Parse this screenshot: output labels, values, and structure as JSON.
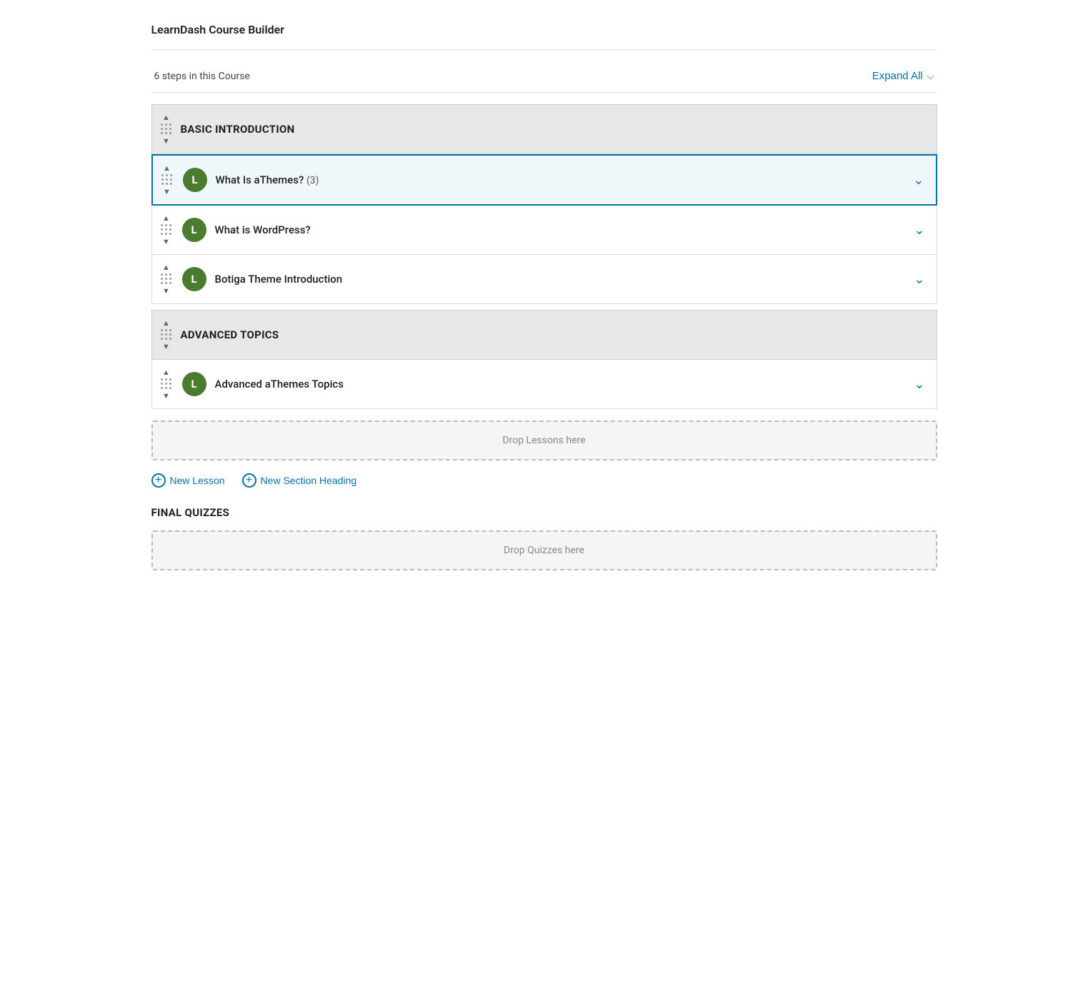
{
  "app": {
    "title": "LearnDash Course Builder"
  },
  "course": {
    "steps_count": "6 steps in this Course",
    "expand_all_label": "Expand All"
  },
  "sections": [
    {
      "type": "section-heading",
      "title": "BASIC INTRODUCTION",
      "id": "basic-intro"
    },
    {
      "type": "lesson",
      "icon_letter": "L",
      "title": "What Is aThemes?",
      "count": "(3)",
      "highlighted": true,
      "id": "what-is-athemes"
    },
    {
      "type": "lesson",
      "icon_letter": "L",
      "title": "What is WordPress?",
      "count": "",
      "highlighted": false,
      "id": "what-is-wordpress"
    },
    {
      "type": "lesson",
      "icon_letter": "L",
      "title": "Botiga Theme Introduction",
      "count": "",
      "highlighted": false,
      "id": "botiga-intro"
    },
    {
      "type": "section-heading",
      "title": "ADVANCED TOPICS",
      "id": "advanced-topics"
    },
    {
      "type": "lesson",
      "icon_letter": "L",
      "title": "Advanced aThemes Topics",
      "count": "",
      "highlighted": false,
      "id": "advanced-athemes"
    }
  ],
  "drop_zone": {
    "lessons_label": "Drop Lessons here",
    "quizzes_label": "Drop Quizzes here"
  },
  "actions": {
    "new_lesson_label": "New Lesson",
    "new_section_label": "New Section Heading"
  },
  "final_quizzes": {
    "title": "FINAL QUIZZES"
  }
}
